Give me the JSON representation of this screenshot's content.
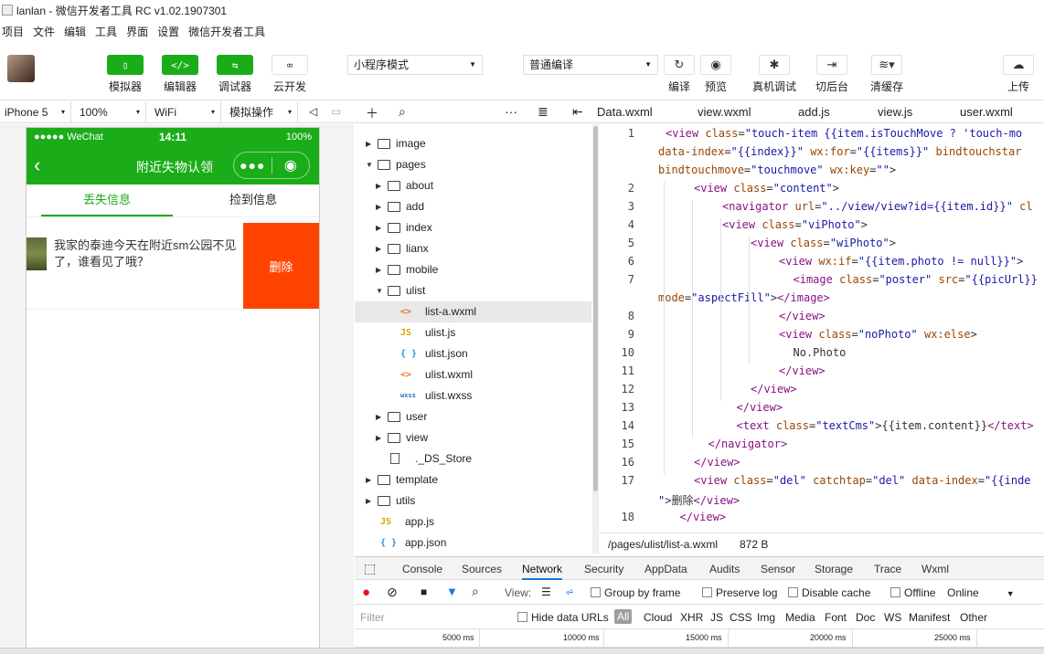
{
  "window": {
    "title": "lanlan - 微信开发者工具 RC v1.02.1907301"
  },
  "menu": [
    "项目",
    "文件",
    "编辑",
    "工具",
    "界面",
    "设置",
    "微信开发者工具"
  ],
  "toolbar": {
    "simulator": "模拟器",
    "editor": "编辑器",
    "debugger": "调试器",
    "cloud": "云开发",
    "mode": "小程序模式",
    "compile_mode": "普通编译",
    "compile": "编译",
    "preview": "预览",
    "remote_debug": "真机调试",
    "background": "切后台",
    "clear_cache": "清缓存",
    "upload": "上传"
  },
  "simulator_bar": {
    "device": "iPhone 5",
    "zoom": "100%",
    "network": "WiFi",
    "operation": "模拟操作"
  },
  "phone": {
    "carrier": "●●●●● WeChat",
    "time": "14:11",
    "battery": "100%",
    "nav_title": "附近失物认领",
    "tabs": [
      "丢失信息",
      "捡到信息"
    ],
    "item_text": "我家的泰迪今天在附近sm公园不见了，谁看见了哦？",
    "delete_label": "删除"
  },
  "file_tree": [
    {
      "name": "image",
      "type": "folder",
      "depth": 0,
      "open": false
    },
    {
      "name": "pages",
      "type": "folder",
      "depth": 0,
      "open": true
    },
    {
      "name": "about",
      "type": "folder",
      "depth": 1,
      "open": false
    },
    {
      "name": "add",
      "type": "folder",
      "depth": 1,
      "open": false
    },
    {
      "name": "index",
      "type": "folder",
      "depth": 1,
      "open": false
    },
    {
      "name": "lianx",
      "type": "folder",
      "depth": 1,
      "open": false
    },
    {
      "name": "mobile",
      "type": "folder",
      "depth": 1,
      "open": false
    },
    {
      "name": "ulist",
      "type": "folder",
      "depth": 1,
      "open": true
    },
    {
      "name": "list-a.wxml",
      "type": "wxml",
      "depth": 2,
      "selected": true
    },
    {
      "name": "ulist.js",
      "type": "js",
      "depth": 2
    },
    {
      "name": "ulist.json",
      "type": "json",
      "depth": 2
    },
    {
      "name": "ulist.wxml",
      "type": "wxml",
      "depth": 2
    },
    {
      "name": "ulist.wxss",
      "type": "wxss",
      "depth": 2
    },
    {
      "name": "user",
      "type": "folder",
      "depth": 1,
      "open": false
    },
    {
      "name": "view",
      "type": "folder",
      "depth": 1,
      "open": false
    },
    {
      "name": "._DS_Store",
      "type": "file",
      "depth": 1
    },
    {
      "name": "template",
      "type": "folder",
      "depth": 0,
      "open": false
    },
    {
      "name": "utils",
      "type": "folder",
      "depth": 0,
      "open": false
    },
    {
      "name": "app.js",
      "type": "js",
      "depth": 0
    },
    {
      "name": "app.json",
      "type": "json",
      "depth": 0
    }
  ],
  "file_icons": {
    "wxml": "<>",
    "js": "JS",
    "json": "{ }",
    "wxss": "wxss",
    "file": ""
  },
  "editor_tabs": [
    "Data.wxml",
    "view.wxml",
    "add.js",
    "view.js",
    "user.wxml"
  ],
  "code_lines": [
    {
      "num": "1",
      "indent": 0,
      "html": "<span class='tg'>&lt;view</span> <span class='at'>class</span>=<span class='st'>\"touch-item {{item.isTouchMove ? 'touch-mo</span>"
    },
    {
      "num": "",
      "indent": -1,
      "html": "<span class='at'>data-index</span>=<span class='st'>\"{{index}}\"</span> <span class='at'>wx:for</span>=<span class='st'>\"{{items}}\"</span> <span class='at'>bindtouchstar</span>"
    },
    {
      "num": "",
      "indent": -1,
      "html": "<span class='at'>bindtouchmove</span>=<span class='st'>\"touchmove\"</span> <span class='at'>wx:key</span>=<span class='st'>\"\"</span>&gt;"
    },
    {
      "num": "2",
      "indent": 1,
      "html": "<span class='tg'>&lt;view</span> <span class='at'>class</span>=<span class='st'>\"content\"</span>&gt;"
    },
    {
      "num": "3",
      "indent": 2,
      "html": "<span class='tg'>&lt;navigator</span> <span class='at'>url</span>=<span class='st'>\"../view/view?id={{item.id}}\"</span> <span class='at'>cl</span>"
    },
    {
      "num": "4",
      "indent": 2,
      "html": "<span class='tg'>&lt;view</span> <span class='at'>class</span>=<span class='st'>\"viPhoto\"</span>&gt;"
    },
    {
      "num": "5",
      "indent": 3,
      "html": "<span class='tg'>&lt;view</span> <span class='at'>class</span>=<span class='st'>\"wiPhoto\"</span>&gt;"
    },
    {
      "num": "6",
      "indent": 4,
      "html": "<span class='tg'>&lt;view</span> <span class='at'>wx:if</span>=<span class='st'>\"{{item.photo != null}}\"</span>&gt;"
    },
    {
      "num": "7",
      "indent": 4.5,
      "html": "<span class='tg'>&lt;image</span> <span class='at'>class</span>=<span class='st'>\"poster\"</span> <span class='at'>src</span>=<span class='st'>\"{{picUrl}}</span>"
    },
    {
      "num": "",
      "indent": -1,
      "html": "<span class='at'>mode</span>=<span class='st'>\"aspectFill\"</span>&gt;<span class='tg'>&lt;/image&gt;</span>"
    },
    {
      "num": "8",
      "indent": 4,
      "html": "<span class='tg'>&lt;/view&gt;</span>"
    },
    {
      "num": "9",
      "indent": 4,
      "html": "<span class='tg'>&lt;view</span> <span class='at'>class</span>=<span class='st'>\"noPhoto\"</span> <span class='at'>wx:else</span>&gt;"
    },
    {
      "num": "10",
      "indent": 4.5,
      "html": "No.Photo"
    },
    {
      "num": "11",
      "indent": 4,
      "html": "<span class='tg'>&lt;/view&gt;</span>"
    },
    {
      "num": "12",
      "indent": 3,
      "html": "<span class='tg'>&lt;/view&gt;</span>"
    },
    {
      "num": "13",
      "indent": 2.5,
      "html": "<span class='tg'>&lt;/view&gt;</span>"
    },
    {
      "num": "14",
      "indent": 2.5,
      "html": "<span class='tg'>&lt;text</span> <span class='at'>class</span>=<span class='st'>\"textCms\"</span>&gt;{{item.content}}<span class='tg'>&lt;/text&gt;</span>"
    },
    {
      "num": "15",
      "indent": 1.5,
      "html": "<span class='tg'>&lt;/navigator&gt;</span>"
    },
    {
      "num": "16",
      "indent": 1,
      "html": "<span class='tg'>&lt;/view&gt;</span>"
    },
    {
      "num": "17",
      "indent": 1,
      "html": "<span class='tg'>&lt;view</span> <span class='at'>class</span>=<span class='st'>\"del\"</span> <span class='at'>catchtap</span>=<span class='st'>\"del\"</span> <span class='at'>data-index</span>=<span class='st'>\"{{inde</span>"
    },
    {
      "num": "",
      "indent": -1,
      "html": "<span class='st'>\"</span>&gt;删除<span class='tg'>&lt;/view&gt;</span>"
    },
    {
      "num": "18",
      "indent": 0.5,
      "html": "<span class='tg'>&lt;/view&gt;</span>"
    }
  ],
  "status": {
    "path": "/pages/ulist/list-a.wxml",
    "size": "872 B"
  },
  "devtools": {
    "tabs": [
      "Console",
      "Sources",
      "Network",
      "Security",
      "AppData",
      "Audits",
      "Sensor",
      "Storage",
      "Trace",
      "Wxml"
    ],
    "active_tab": "Network",
    "view_label": "View:",
    "group_by_frame": "Group by frame",
    "preserve_log": "Preserve log",
    "disable_cache": "Disable cache",
    "offline": "Offline",
    "online": "Online",
    "filter_placeholder": "Filter",
    "hide_data_urls": "Hide data URLs",
    "filter_types": [
      "All",
      "Cloud",
      "XHR",
      "JS",
      "CSS",
      "Img",
      "Media",
      "Font",
      "Doc",
      "WS",
      "Manifest",
      "Other"
    ],
    "timeline": [
      "5000 ms",
      "10000 ms",
      "15000 ms",
      "20000 ms",
      "25000 ms"
    ]
  }
}
